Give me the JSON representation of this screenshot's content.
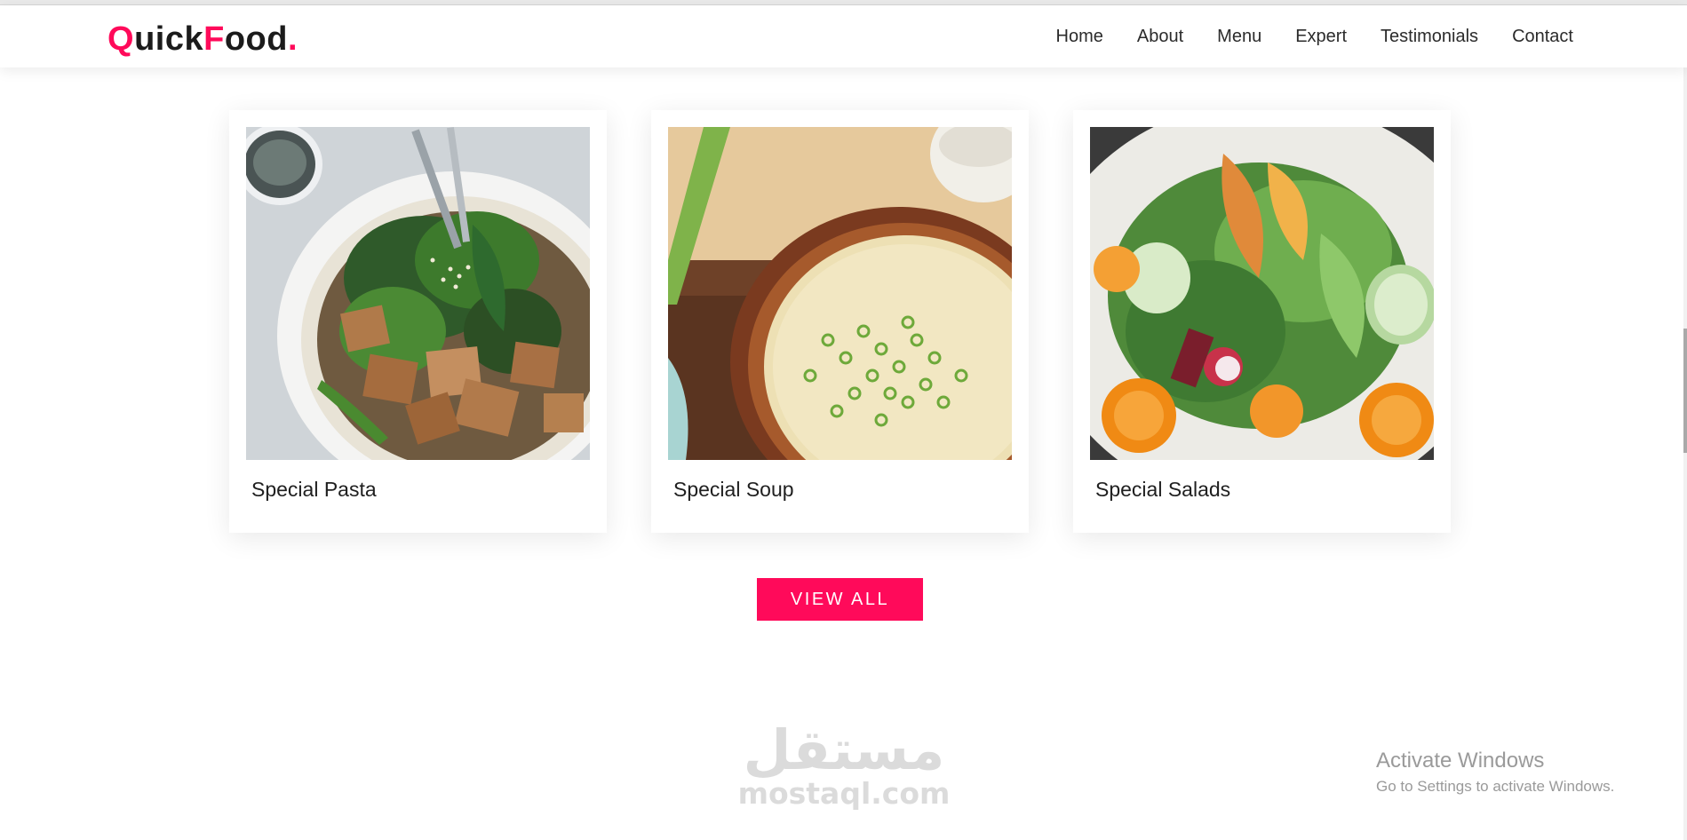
{
  "header": {
    "logo": {
      "q": "Q",
      "uick": "uick",
      "f": "F",
      "ood": "ood",
      "dot": "."
    },
    "nav": [
      "Home",
      "About",
      "Menu",
      "Expert",
      "Testimonials",
      "Contact"
    ]
  },
  "cards": [
    {
      "title": "Special Pasta",
      "image": "pasta-bowl-image"
    },
    {
      "title": "Special Soup",
      "image": "soup-bowl-image"
    },
    {
      "title": "Special Salads",
      "image": "salad-plate-image"
    }
  ],
  "view_all": "VIEW ALL",
  "watermark": {
    "arabic": "مستقل",
    "latin": "mostaql.com"
  },
  "activate_windows": {
    "title": "Activate Windows",
    "subtitle": "Go to Settings to activate Windows."
  },
  "colors": {
    "accent": "#ff0a5a",
    "text": "#1b1b1b"
  }
}
